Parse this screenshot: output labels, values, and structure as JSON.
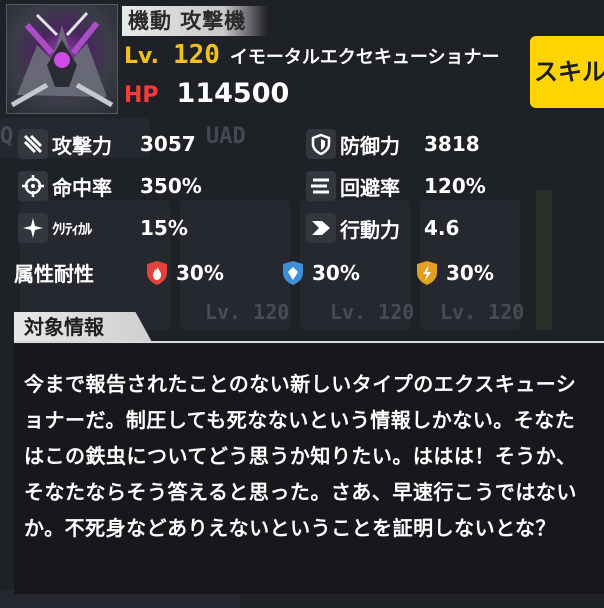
{
  "header": {
    "type_label": "機動 攻撃機",
    "level_tag": "Lv.",
    "level_value": "120",
    "unit_name": "イモータルエクセキューショナー",
    "hp_tag": "HP",
    "hp_value": "114500",
    "skill_button": "スキル"
  },
  "stats": [
    {
      "label": "攻撃力",
      "value": "3057",
      "icon": "sword-slash-icon"
    },
    {
      "label": "防御力",
      "value": "3818",
      "icon": "shield-icon"
    },
    {
      "label": "命中率",
      "value": "350%",
      "icon": "crosshair-icon"
    },
    {
      "label": "回避率",
      "value": "120%",
      "icon": "evasion-lines-icon"
    },
    {
      "label": "ｸﾘﾃｨｶﾙ",
      "value": "15%",
      "icon": "sparkle-icon"
    },
    {
      "label": "行動力",
      "value": "4.6",
      "icon": "chevron-right-icon"
    }
  ],
  "resistance": {
    "label": "属性耐性",
    "items": [
      {
        "element": "fire",
        "icon": "fire-shield-icon",
        "value": "30%",
        "color": "#e0443c"
      },
      {
        "element": "ice",
        "icon": "ice-shield-icon",
        "value": "30%",
        "color": "#3c8fd8"
      },
      {
        "element": "thunder",
        "icon": "thunder-shield-icon",
        "value": "30%",
        "color": "#e0a020"
      }
    ]
  },
  "info": {
    "section_title": "対象情報",
    "description": "今まで報告されたことのない新しいタイプのエクスキューショナーだ。制圧しても死なないという情報しかない。そなたはこの鉄虫についてどう思うか知りたい。ははは！そうか、そなたならそう答えると思った。さあ、早速行こうではないか。不死身などありえないということを証明しないとな？"
  },
  "colors": {
    "accent_yellow": "#ffd400",
    "level_gold": "#f0c020",
    "hp_red": "#ff3a3a",
    "background": "#1e2125"
  }
}
